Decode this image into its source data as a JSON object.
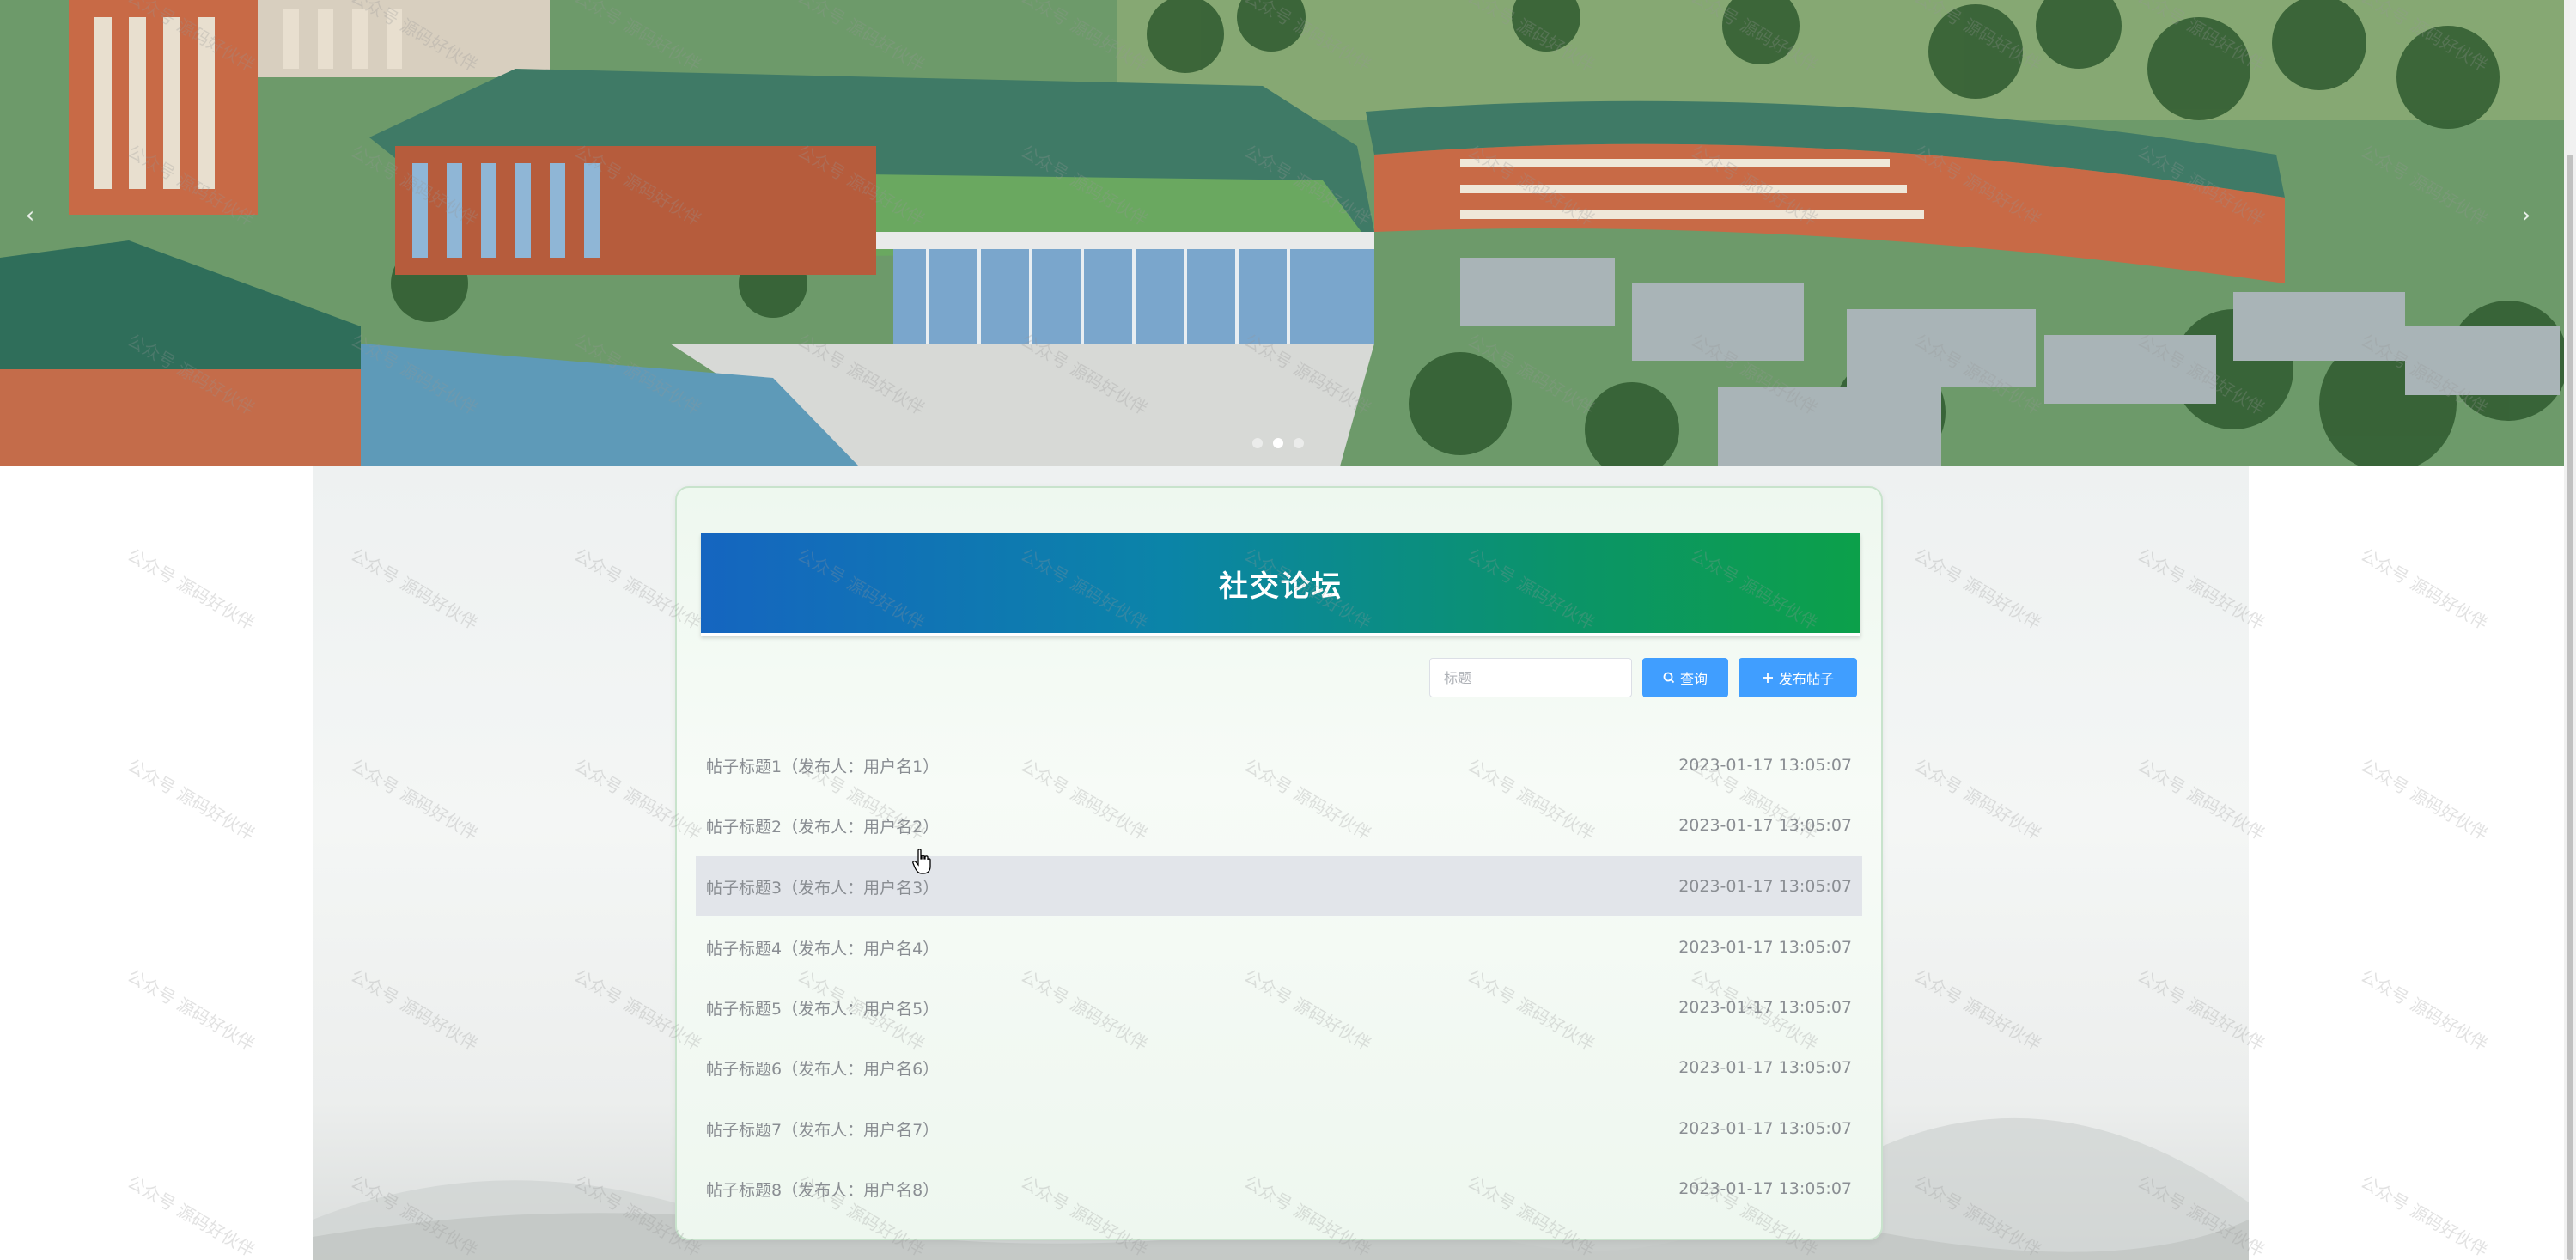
{
  "carousel": {
    "prev_glyph": "‹",
    "next_glyph": "›",
    "dot_count": 3,
    "active_dot": 1
  },
  "forum": {
    "title": "社交论坛",
    "search_placeholder": "标题",
    "query_button": "查询",
    "publish_button": "发布帖子",
    "posts": [
      {
        "title": "帖子标题1（发布人：用户名1）",
        "time": "2023-01-17 13:05:07"
      },
      {
        "title": "帖子标题2（发布人：用户名2）",
        "time": "2023-01-17 13:05:07"
      },
      {
        "title": "帖子标题3（发布人：用户名3）",
        "time": "2023-01-17 13:05:07"
      },
      {
        "title": "帖子标题4（发布人：用户名4）",
        "time": "2023-01-17 13:05:07"
      },
      {
        "title": "帖子标题5（发布人：用户名5）",
        "time": "2023-01-17 13:05:07"
      },
      {
        "title": "帖子标题6（发布人：用户名6）",
        "time": "2023-01-17 13:05:07"
      },
      {
        "title": "帖子标题7（发布人：用户名7）",
        "time": "2023-01-17 13:05:07"
      },
      {
        "title": "帖子标题8（发布人：用户名8）",
        "time": "2023-01-17 13:05:07"
      }
    ],
    "hovered_post": 2
  },
  "icons": {
    "query": "search-icon",
    "publish": "plus-icon",
    "cursor": "hand-pointer-icon"
  },
  "colors": {
    "accent": "#409eff",
    "title_gradient_start": "#1565c0",
    "title_gradient_end": "#0ca04a",
    "row_hover": "#e2e5ea",
    "card_border": "#c8e3cc"
  },
  "watermark": "公众号 源码好伙伴"
}
